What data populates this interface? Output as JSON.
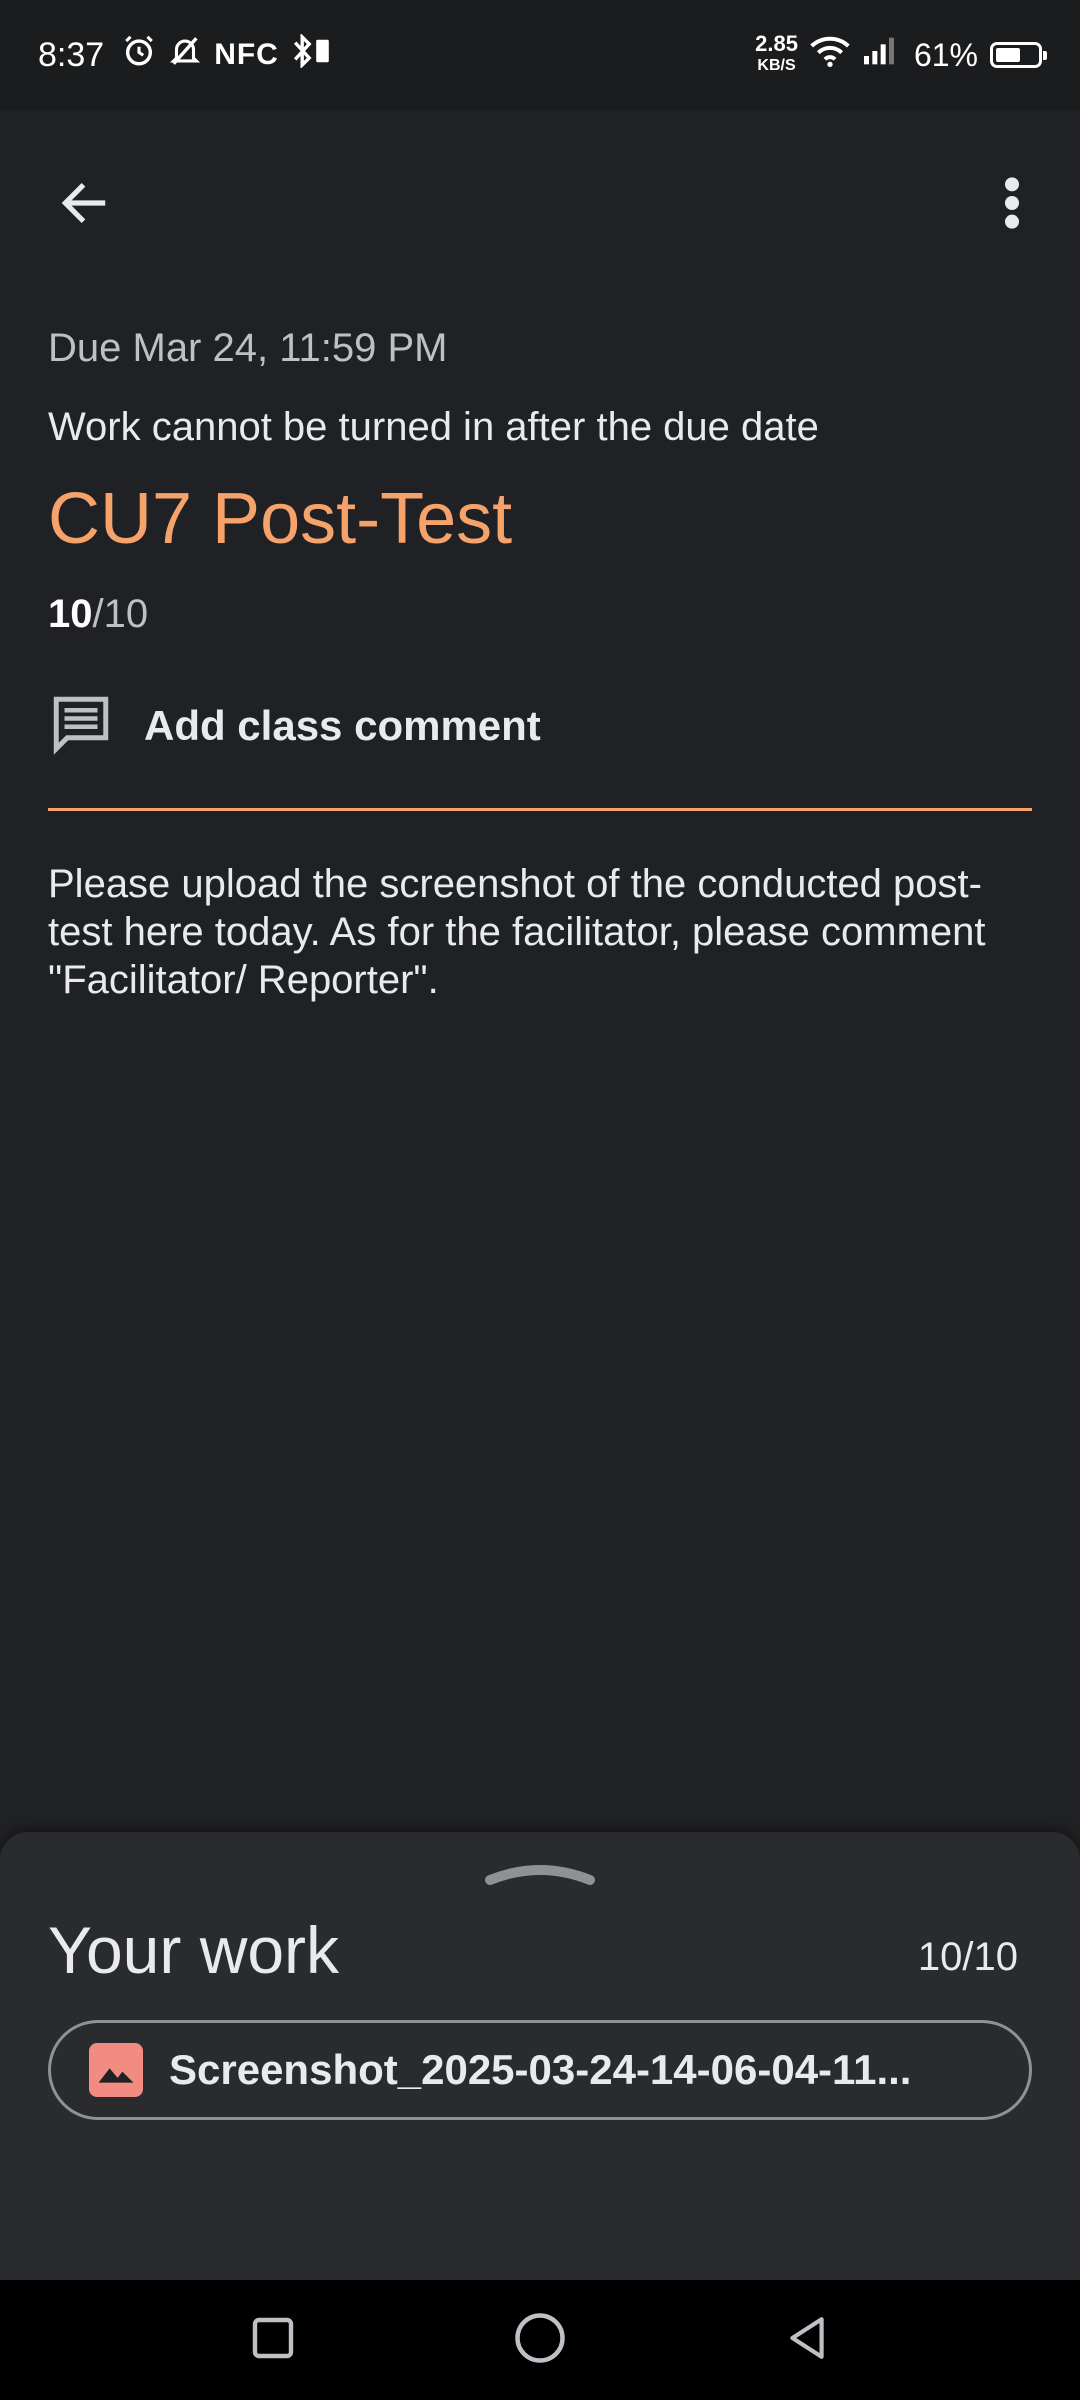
{
  "status_bar": {
    "time": "8:37",
    "icons": [
      "alarm-icon",
      "mute-icon"
    ],
    "nfc": "NFC",
    "speed_value": "2.85",
    "speed_unit": "KB/S",
    "battery_pct": "61%",
    "battery_level": 0.61
  },
  "app_bar": {
    "back_icon": "arrow-left-icon",
    "more_icon": "more-vert-icon"
  },
  "assignment": {
    "due": "Due Mar 24, 11:59 PM",
    "late_note": "Work cannot be turned in after the due date",
    "title": "CU7 Post-Test",
    "points_earned": "10",
    "points_total": "/10",
    "comment_label": "Add class comment",
    "instructions": "Please upload the screenshot of the conducted post-test here today. As for the facilitator, please comment \"Facilitator/ Reporter\"."
  },
  "your_work": {
    "title": "Your work",
    "points": "10/10",
    "attachment_name": "Screenshot_2025-03-24-14-06-04-11..."
  },
  "colors": {
    "accent": "#f6a26b",
    "background": "#202124",
    "sheet": "#2a2b2e",
    "attachment_icon": "#f28b82"
  }
}
